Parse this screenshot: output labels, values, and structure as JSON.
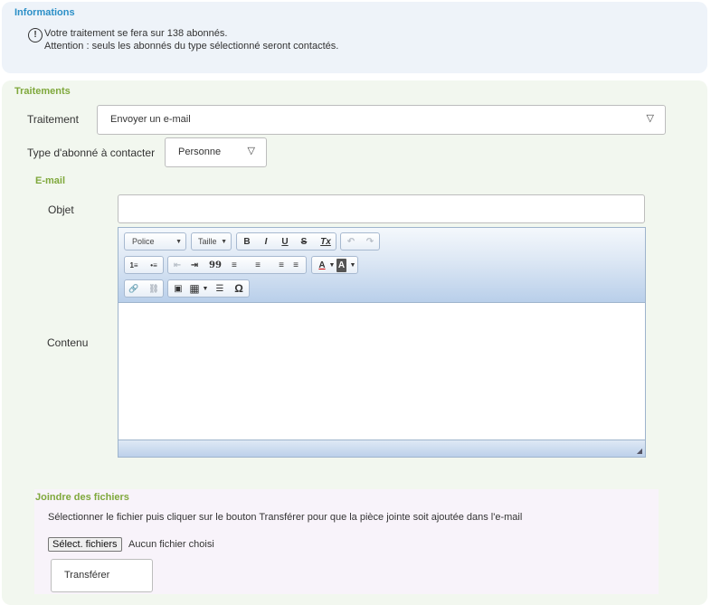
{
  "informations": {
    "title": "Informations",
    "icon": "info-icon",
    "line1": "Votre traitement se fera sur 138 abonnés.",
    "line2": "Attention : seuls les abonnés du type sélectionné seront contactés."
  },
  "traitements": {
    "title": "Traitements",
    "traitement_label": "Traitement",
    "traitement_value": "Envoyer un e-mail",
    "type_label": "Type d'abonné à contacter",
    "type_value": "Personne"
  },
  "email": {
    "title": "E-mail",
    "objet_label": "Objet",
    "objet_value": "",
    "contenu_label": "Contenu",
    "toolbar": {
      "font_combo": "Police",
      "size_combo": "Taille",
      "bold": "B",
      "italic": "I",
      "underline": "U",
      "strike": "S",
      "remove_format": "Tx",
      "undo": "↶",
      "redo": "↷",
      "numbered_list": "1≡",
      "bullet_list": "•≡",
      "outdent": "⇤",
      "indent": "⇥",
      "blockquote": "99",
      "align_left": "≡",
      "align_center": "≡",
      "align_right": "≡",
      "justify": "≡",
      "text_color": "A",
      "bg_color": "A",
      "link": "🔗",
      "unlink": "⛓",
      "image": "▣",
      "table": "▦",
      "hr": "☰",
      "special_char": "Ω"
    }
  },
  "attachments": {
    "title": "Joindre des fichiers",
    "instructions": "Sélectionner le fichier puis cliquer sur le bouton Transférer pour que la pièce jointe soit ajoutée dans l'e-mail",
    "file_button": "Sélect. fichiers",
    "file_status": "Aucun fichier choisi",
    "transfer_button": "Transférer"
  }
}
